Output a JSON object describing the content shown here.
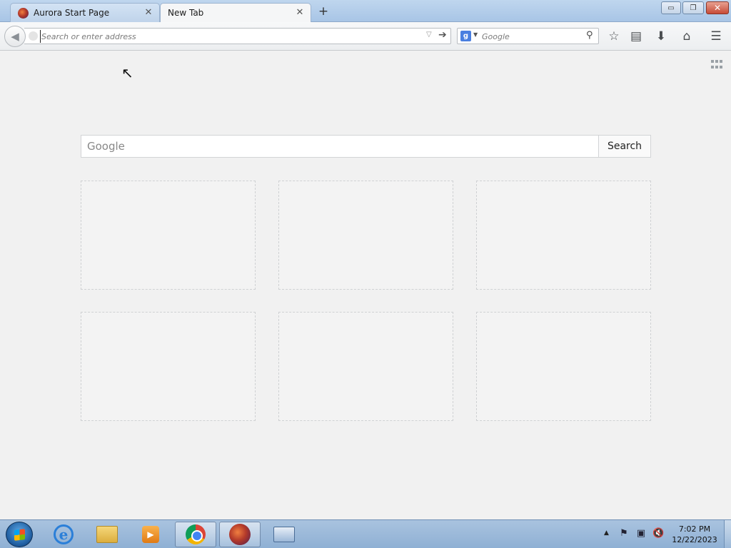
{
  "browser": {
    "tabs": [
      {
        "label": "Aurora Start Page",
        "active": false
      },
      {
        "label": "New Tab",
        "active": true
      }
    ],
    "new_tab_symbol": "+",
    "close_symbol": "✕"
  },
  "window_controls": {
    "minimize": "▭",
    "maximize": "❐",
    "close": "✕"
  },
  "toolbar": {
    "back_icon": "arrow-left-icon",
    "url": {
      "value": "",
      "placeholder": "Search or enter address"
    },
    "search": {
      "engine": "Google",
      "engine_glyph": "g",
      "value": "",
      "placeholder": "Google"
    },
    "icons": [
      "bookmark-star-icon",
      "reading-list-icon",
      "downloads-icon",
      "home-icon",
      "menu-icon"
    ]
  },
  "new_tab_page": {
    "search": {
      "placeholder": "Google",
      "button_label": "Search"
    },
    "tiles_count_note": ""
  },
  "taskbar": {
    "pinned": [
      "internet-explorer-icon",
      "file-explorer-icon",
      "media-player-icon",
      "chrome-icon",
      "firefox-aurora-icon",
      "on-screen-keyboard-icon"
    ],
    "clock": {
      "time": "7:02 PM",
      "date": "12/22/2023"
    }
  },
  "colors": {
    "page_bg": "#f1f1f1",
    "taskbar": "#a9c3df",
    "titlebar": "#bfd6ee"
  }
}
